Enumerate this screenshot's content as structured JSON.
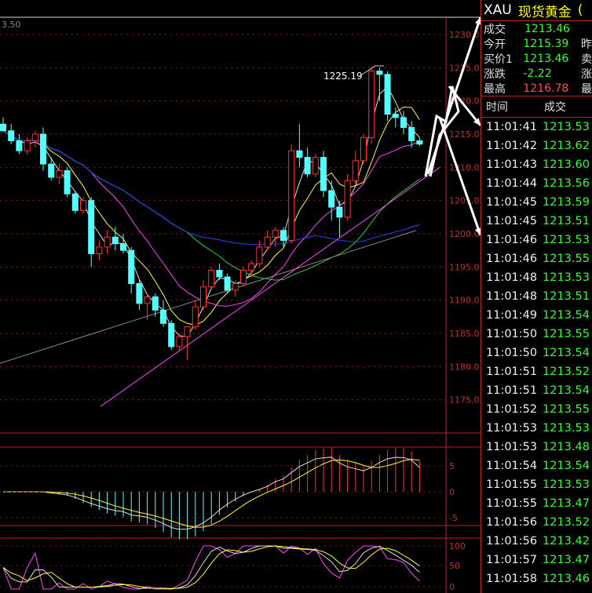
{
  "chart_data": {
    "type": "candlestick",
    "corner_label": "3.50",
    "price_axis": {
      "min": 1170,
      "max": 1230,
      "ticks": [
        "1230.0",
        "1225.0",
        "1220.0",
        "1215.0",
        "1210.0",
        "1205.0",
        "1200.0",
        "1195.0",
        "1190.0",
        "1185.0",
        "1180.0",
        "1175.0"
      ]
    },
    "peak_annotation": "1225.19",
    "candles": [
      {
        "o": 1216.5,
        "h": 1217.5,
        "l": 1215.5,
        "c": 1215.5
      },
      {
        "o": 1215.5,
        "h": 1216.5,
        "l": 1213.5,
        "c": 1214.0
      },
      {
        "o": 1214.0,
        "h": 1215.0,
        "l": 1212.0,
        "c": 1212.5
      },
      {
        "o": 1212.5,
        "h": 1214.5,
        "l": 1212.0,
        "c": 1214.0
      },
      {
        "o": 1214.0,
        "h": 1215.5,
        "l": 1213.0,
        "c": 1215.0
      },
      {
        "o": 1215.0,
        "h": 1216.0,
        "l": 1209.5,
        "c": 1210.5
      },
      {
        "o": 1210.5,
        "h": 1211.5,
        "l": 1208.0,
        "c": 1208.5
      },
      {
        "o": 1208.5,
        "h": 1210.5,
        "l": 1207.5,
        "c": 1209.5
      },
      {
        "o": 1209.5,
        "h": 1210.0,
        "l": 1205.5,
        "c": 1206.0
      },
      {
        "o": 1206.0,
        "h": 1206.5,
        "l": 1203.0,
        "c": 1203.5
      },
      {
        "o": 1203.5,
        "h": 1205.5,
        "l": 1203.0,
        "c": 1205.0
      },
      {
        "o": 1205.0,
        "h": 1205.5,
        "l": 1195.0,
        "c": 1197.0
      },
      {
        "o": 1197.0,
        "h": 1199.0,
        "l": 1196.0,
        "c": 1198.0
      },
      {
        "o": 1198.0,
        "h": 1200.5,
        "l": 1197.0,
        "c": 1199.5
      },
      {
        "o": 1199.5,
        "h": 1201.0,
        "l": 1197.5,
        "c": 1198.5
      },
      {
        "o": 1198.5,
        "h": 1200.0,
        "l": 1197.0,
        "c": 1197.5
      },
      {
        "o": 1197.5,
        "h": 1198.0,
        "l": 1191.0,
        "c": 1192.5
      },
      {
        "o": 1192.5,
        "h": 1193.0,
        "l": 1188.5,
        "c": 1189.5
      },
      {
        "o": 1189.5,
        "h": 1191.0,
        "l": 1187.0,
        "c": 1190.5
      },
      {
        "o": 1190.5,
        "h": 1191.0,
        "l": 1187.5,
        "c": 1188.5
      },
      {
        "o": 1188.5,
        "h": 1190.0,
        "l": 1186.0,
        "c": 1186.5
      },
      {
        "o": 1186.5,
        "h": 1187.0,
        "l": 1182.5,
        "c": 1183.0
      },
      {
        "o": 1183.0,
        "h": 1185.0,
        "l": 1182.5,
        "c": 1184.5
      },
      {
        "o": 1184.5,
        "h": 1186.0,
        "l": 1181.0,
        "c": 1186.0
      },
      {
        "o": 1186.0,
        "h": 1190.0,
        "l": 1185.5,
        "c": 1189.0
      },
      {
        "o": 1189.0,
        "h": 1193.0,
        "l": 1188.5,
        "c": 1192.0
      },
      {
        "o": 1192.0,
        "h": 1195.0,
        "l": 1191.5,
        "c": 1194.5
      },
      {
        "o": 1194.5,
        "h": 1195.5,
        "l": 1193.0,
        "c": 1193.5
      },
      {
        "o": 1193.5,
        "h": 1194.0,
        "l": 1191.0,
        "c": 1191.5
      },
      {
        "o": 1191.5,
        "h": 1193.0,
        "l": 1190.5,
        "c": 1192.5
      },
      {
        "o": 1192.5,
        "h": 1195.0,
        "l": 1192.0,
        "c": 1194.5
      },
      {
        "o": 1194.5,
        "h": 1196.0,
        "l": 1193.5,
        "c": 1195.5
      },
      {
        "o": 1195.5,
        "h": 1199.0,
        "l": 1195.0,
        "c": 1198.0
      },
      {
        "o": 1198.0,
        "h": 1200.5,
        "l": 1197.5,
        "c": 1199.5
      },
      {
        "o": 1199.5,
        "h": 1201.0,
        "l": 1198.0,
        "c": 1200.5
      },
      {
        "o": 1200.5,
        "h": 1201.0,
        "l": 1198.0,
        "c": 1199.0
      },
      {
        "o": 1199.0,
        "h": 1213.5,
        "l": 1198.5,
        "c": 1212.5
      },
      {
        "o": 1212.5,
        "h": 1216.5,
        "l": 1210.0,
        "c": 1211.5
      },
      {
        "o": 1211.5,
        "h": 1213.0,
        "l": 1208.5,
        "c": 1209.0
      },
      {
        "o": 1209.0,
        "h": 1212.0,
        "l": 1208.5,
        "c": 1211.5
      },
      {
        "o": 1211.5,
        "h": 1212.5,
        "l": 1205.5,
        "c": 1206.5
      },
      {
        "o": 1206.5,
        "h": 1208.0,
        "l": 1202.0,
        "c": 1204.0
      },
      {
        "o": 1204.0,
        "h": 1205.0,
        "l": 1199.5,
        "c": 1202.5
      },
      {
        "o": 1202.5,
        "h": 1209.0,
        "l": 1202.0,
        "c": 1208.0
      },
      {
        "o": 1208.0,
        "h": 1212.5,
        "l": 1207.5,
        "c": 1211.0
      },
      {
        "o": 1211.0,
        "h": 1215.0,
        "l": 1210.5,
        "c": 1214.5
      },
      {
        "o": 1214.5,
        "h": 1225.2,
        "l": 1213.5,
        "c": 1224.5
      },
      {
        "o": 1224.5,
        "h": 1225.0,
        "l": 1220.0,
        "c": 1224.0
      },
      {
        "o": 1224.0,
        "h": 1224.5,
        "l": 1217.0,
        "c": 1218.0
      },
      {
        "o": 1218.0,
        "h": 1219.0,
        "l": 1216.0,
        "c": 1217.5
      },
      {
        "o": 1217.5,
        "h": 1218.5,
        "l": 1215.0,
        "c": 1216.0
      },
      {
        "o": 1216.0,
        "h": 1217.0,
        "l": 1213.0,
        "c": 1214.0
      },
      {
        "o": 1214.0,
        "h": 1214.5,
        "l": 1213.2,
        "c": 1213.5
      }
    ],
    "macd_axis": {
      "ticks": [
        "5",
        "0",
        "-5"
      ]
    },
    "kdj_axis": {
      "ticks": [
        "100",
        "50",
        "0"
      ]
    },
    "colors": {
      "up": "#ff3333",
      "down": "#54ffff",
      "ma_white": "#e0e0e0",
      "ma_yellow": "#ffff33",
      "ma_purple": "#ff44ff",
      "ma_green": "#33cc33",
      "ma_blue": "#2244ff",
      "ma_gray": "#888888",
      "grid": "#c02020"
    }
  },
  "side": {
    "symbol": "XAU",
    "name": "现货黄金",
    "extra": "(",
    "quote": [
      {
        "label": "成交",
        "value": "1213.46",
        "color": "green",
        "label2": ""
      },
      {
        "label": "今开",
        "value": "1215.39",
        "color": "green",
        "label2": "昨"
      },
      {
        "label": "买价1",
        "value": "1213.46",
        "color": "green",
        "label2": "卖"
      },
      {
        "label": "涨跌",
        "value": "-2.22",
        "color": "green",
        "label2": "涨"
      },
      {
        "label": "最高",
        "value": "1216.78",
        "color": "red",
        "label2": "最"
      }
    ],
    "ticks_header": {
      "time": "时间",
      "price": "成交"
    },
    "ticks": [
      {
        "time": "11:01:41",
        "price": "1213.53"
      },
      {
        "time": "11:01:42",
        "price": "1213.62"
      },
      {
        "time": "11:01:43",
        "price": "1213.60"
      },
      {
        "time": "11:01:44",
        "price": "1213.56"
      },
      {
        "time": "11:01:45",
        "price": "1213.59"
      },
      {
        "time": "11:01:45",
        "price": "1213.51"
      },
      {
        "time": "11:01:46",
        "price": "1213.53"
      },
      {
        "time": "11:01:46",
        "price": "1213.55"
      },
      {
        "time": "11:01:48",
        "price": "1213.53"
      },
      {
        "time": "11:01:48",
        "price": "1213.51"
      },
      {
        "time": "11:01:49",
        "price": "1213.54"
      },
      {
        "time": "11:01:50",
        "price": "1213.55"
      },
      {
        "time": "11:01:50",
        "price": "1213.54"
      },
      {
        "time": "11:01:51",
        "price": "1213.52"
      },
      {
        "time": "11:01:51",
        "price": "1213.54"
      },
      {
        "time": "11:01:52",
        "price": "1213.55"
      },
      {
        "time": "11:01:53",
        "price": "1213.53"
      },
      {
        "time": "11:01:53",
        "price": "1213.48"
      },
      {
        "time": "11:01:54",
        "price": "1213.54"
      },
      {
        "time": "11:01:55",
        "price": "1213.53"
      },
      {
        "time": "11:01:55",
        "price": "1213.47"
      },
      {
        "time": "11:01:56",
        "price": "1213.52"
      },
      {
        "time": "11:01:56",
        "price": "1213.42"
      },
      {
        "time": "11:01:57",
        "price": "1213.47"
      },
      {
        "time": "11:01:58",
        "price": "1213.46"
      }
    ]
  }
}
